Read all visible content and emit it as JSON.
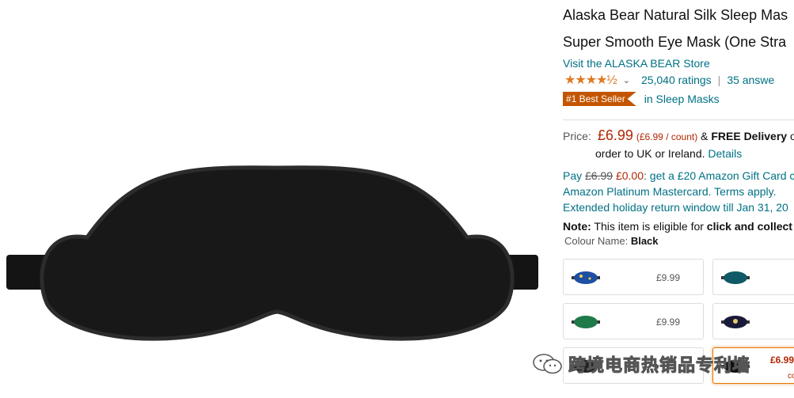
{
  "product": {
    "title_line1": "Alaska Bear Natural Silk Sleep Mas",
    "title_line2": "Super Smooth Eye Mask (One Stra",
    "store_link": "Visit the ALASKA BEAR Store",
    "rating_stars": "★★★★½",
    "rating_value": 4.5,
    "ratings_count": "25,040 ratings",
    "answers": "35 answe",
    "best_seller_badge": "#1 Best Seller",
    "best_seller_category": "in Sleep Masks"
  },
  "pricing": {
    "label": "Price:",
    "price": "£6.99",
    "per_count": "(£6.99 / count)",
    "delivery_prefix": "&",
    "free_delivery": "FREE Delivery",
    "delivery_suffix": "o",
    "line2": "order to UK or Ireland.",
    "details_link": "Details"
  },
  "promo": {
    "pay": "Pay",
    "old_price": "£6.99",
    "new_price": "£0.00",
    "gift_text": ": get a £20 Amazon Gift Card c",
    "line2": "Amazon Platinum Mastercard. Terms apply.",
    "line3": "Extended holiday return window till Jan 31, 20"
  },
  "note": {
    "label": "Note:",
    "text": " This item is eligible for ",
    "bold": "click and collect"
  },
  "colour": {
    "label": "Colour Name:",
    "value": "Black"
  },
  "swatches": [
    {
      "price": "£9.99",
      "color": "#1d4fa3"
    },
    {
      "price": "",
      "color": "#0f5a66"
    },
    {
      "price": "£9.99",
      "color": "#1f7a4a"
    },
    {
      "price": "",
      "color": "#1a1a3a"
    },
    {
      "price": "",
      "color": "#222222"
    },
    {
      "price": "£6.99",
      "price2": "co",
      "color": "#111111"
    }
  ],
  "watermark": {
    "text": "跨境电商热销品专利墙"
  }
}
